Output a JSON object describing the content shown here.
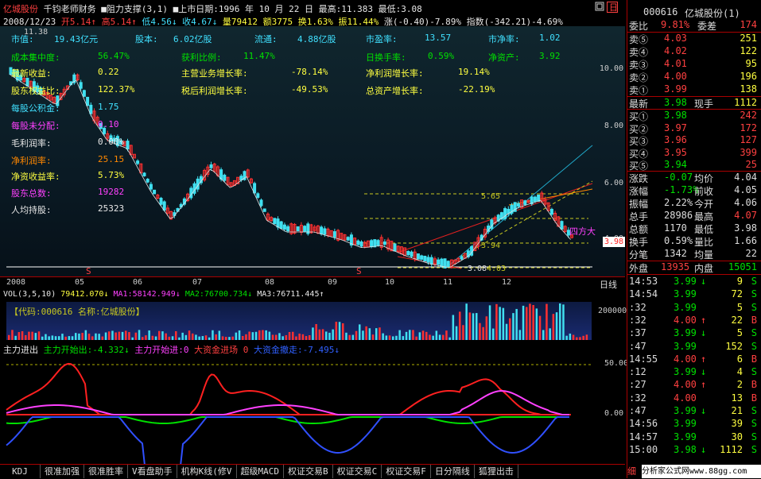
{
  "header": {
    "stock_name": "亿城股份",
    "author": "千钧老师财务",
    "indicator": "阻力支撑(3,1)",
    "listing": "上市日期:1996 年 10 月 22 日",
    "high_max": "最高:11.383",
    "low_min": "最低:3.08",
    "date": "2008/12/23",
    "open": "开5.14",
    "high": "高5.14",
    "low": "低4.56",
    "close": "收4.67",
    "volume": "量79412",
    "amount": "额3775",
    "turnover": "换1.63%",
    "amplitude": "振11.44%",
    "change": "涨(-0.40)-7.89%",
    "index": "指数(-342.21)-4.69%"
  },
  "stats": [
    {
      "label": "市值:",
      "value": "19.43亿元"
    },
    {
      "label": "股本:",
      "value": "6.02亿股"
    },
    {
      "label": "流通:",
      "value": "4.88亿股"
    },
    {
      "label": "市盈率:",
      "value": "13.57"
    },
    {
      "label": "市净率:",
      "value": "1.02"
    },
    {
      "label": "成本集中度:",
      "value": "56.47%"
    },
    {
      "label": "获利比例:",
      "value": "11.47%"
    },
    {
      "label": "日换手率:",
      "value": "0.59%"
    },
    {
      "label": "净资产:",
      "value": "3.92"
    },
    {
      "label": "最新收益:",
      "value": "0.22"
    },
    {
      "label": "主营业务增长率:",
      "value": "-78.14%"
    },
    {
      "label": "净利润增长率:",
      "value": "19.14%"
    },
    {
      "label": "股东权益比:",
      "value": "122.37%"
    },
    {
      "label": "税后利润增长率:",
      "value": "-49.53%"
    },
    {
      "label": "总资产增长率:",
      "value": "-22.19%"
    },
    {
      "label": "每股公积金:",
      "value": "1.75"
    },
    {
      "label": "每股未分配:",
      "value": "0.10"
    },
    {
      "label": "毛利润率:",
      "value": "0.00%"
    },
    {
      "label": "净利润率:",
      "value": "25.15"
    },
    {
      "label": "净资收益率:",
      "value": "5.73%"
    },
    {
      "label": "股东总数:",
      "value": "19282"
    },
    {
      "label": "人均持股:",
      "value": "25323"
    }
  ],
  "chart_labels": {
    "corner_value": "11.38",
    "level_565": "5.65",
    "level_394": "3.94",
    "level_308": "3.08",
    "level_403": "4.03",
    "annotation": "四方大",
    "current_price": "3.98",
    "marker_s": "S"
  },
  "price_ticks": [
    "10.00",
    "8.00",
    "6.00",
    "4.00"
  ],
  "dates": [
    "2008",
    "05",
    "06",
    "07",
    "08",
    "09",
    "10",
    "11",
    "12"
  ],
  "daily_line": "日线",
  "vol": {
    "title": "VOL(3,5,10)",
    "value": "79412.070",
    "ma1": "MA1:58142.949",
    "ma2": "MA2:76700.734",
    "ma3": "MA3:76711.445",
    "code_label": "【代码:000616 名称:亿城股份】",
    "tick": "200000"
  },
  "flow": {
    "title": "主力进出",
    "start_out": "主力开始出:-4.332",
    "start_in": "主力开始进:0",
    "big_in": "大资金进场 0",
    "big_out": "大资金撤走:-7.495",
    "ticks": [
      "50.00",
      "0.00",
      "-50.00"
    ]
  },
  "tabs": [
    "KDJ",
    "很准加强",
    "很准胜率",
    "V看盘助手",
    "机构K线(修V",
    "超级MACD",
    "权证交易B",
    "权证交易C",
    "权证交易F",
    "日分隔线",
    "狐狸出击"
  ],
  "right": {
    "code": "000616",
    "name": "亿城股份(1)",
    "webi_label": "委比",
    "webi_value": "9.81%",
    "weicha_label": "委差",
    "weicha_value": "174",
    "asks": [
      {
        "label": "卖⑤",
        "price": "4.03",
        "vol": "251"
      },
      {
        "label": "卖④",
        "price": "4.02",
        "vol": "122"
      },
      {
        "label": "卖③",
        "price": "4.01",
        "vol": "95"
      },
      {
        "label": "卖②",
        "price": "4.00",
        "vol": "196"
      },
      {
        "label": "卖①",
        "price": "3.99",
        "vol": "138"
      }
    ],
    "last_label": "最新",
    "last_value": "3.98",
    "now_label": "现手",
    "now_value": "1112",
    "bids": [
      {
        "label": "买①",
        "price": "3.98",
        "vol": "242"
      },
      {
        "label": "买②",
        "price": "3.97",
        "vol": "172"
      },
      {
        "label": "买③",
        "price": "3.96",
        "vol": "127"
      },
      {
        "label": "买④",
        "price": "3.95",
        "vol": "399"
      },
      {
        "label": "买⑤",
        "price": "3.94",
        "vol": "25"
      }
    ],
    "quote": [
      {
        "l1": "涨跌",
        "v1": "-0.07",
        "l2": "均价",
        "v2": "4.04"
      },
      {
        "l1": "涨幅",
        "v1": "-1.73%",
        "l2": "前收",
        "v2": "4.05"
      },
      {
        "l1": "振幅",
        "v1": "2.22%",
        "l2": "今开",
        "v2": "4.06"
      },
      {
        "l1": "总手",
        "v1": "28986",
        "l2": "最高",
        "v2": "4.07"
      },
      {
        "l1": "总额",
        "v1": "1170",
        "l2": "最低",
        "v2": "3.98"
      },
      {
        "l1": "换手",
        "v1": "0.59%",
        "l2": "量比",
        "v2": "1.66"
      },
      {
        "l1": "分笔",
        "v1": "1342",
        "l2": "均量",
        "v2": "22"
      }
    ],
    "outer_label": "外盘",
    "outer_value": "13935",
    "inner_label": "内盘",
    "inner_value": "15051",
    "ticks": [
      {
        "t": "14:53",
        "p": "3.99",
        "a": "↓",
        "v": "9",
        "s": "S"
      },
      {
        "t": "14:54",
        "p": "3.99",
        "a": "",
        "v": "72",
        "s": "S"
      },
      {
        "t": ":32",
        "p": "3.99",
        "a": "",
        "v": "5",
        "s": "S"
      },
      {
        "t": ":32",
        "p": "4.00",
        "a": "↑",
        "v": "22",
        "s": "B"
      },
      {
        "t": ":37",
        "p": "3.99",
        "a": "↓",
        "v": "5",
        "s": "S"
      },
      {
        "t": ":47",
        "p": "3.99",
        "a": "",
        "v": "152",
        "s": "S"
      },
      {
        "t": "14:55",
        "p": "4.00",
        "a": "↑",
        "v": "6",
        "s": "B"
      },
      {
        "t": ":12",
        "p": "3.99",
        "a": "↓",
        "v": "4",
        "s": "S"
      },
      {
        "t": ":27",
        "p": "4.00",
        "a": "↑",
        "v": "2",
        "s": "B"
      },
      {
        "t": ":32",
        "p": "4.00",
        "a": "",
        "v": "13",
        "s": "B"
      },
      {
        "t": ":47",
        "p": "3.99",
        "a": "↓",
        "v": "21",
        "s": "S"
      },
      {
        "t": "14:56",
        "p": "3.99",
        "a": "",
        "v": "39",
        "s": "S"
      },
      {
        "t": "14:57",
        "p": "3.99",
        "a": "",
        "v": "30",
        "s": "S"
      },
      {
        "t": "15:00",
        "p": "3.98",
        "a": "↓",
        "v": "1112",
        "s": "S"
      }
    ],
    "footer": "分析家公式网www.88gg.com"
  }
}
